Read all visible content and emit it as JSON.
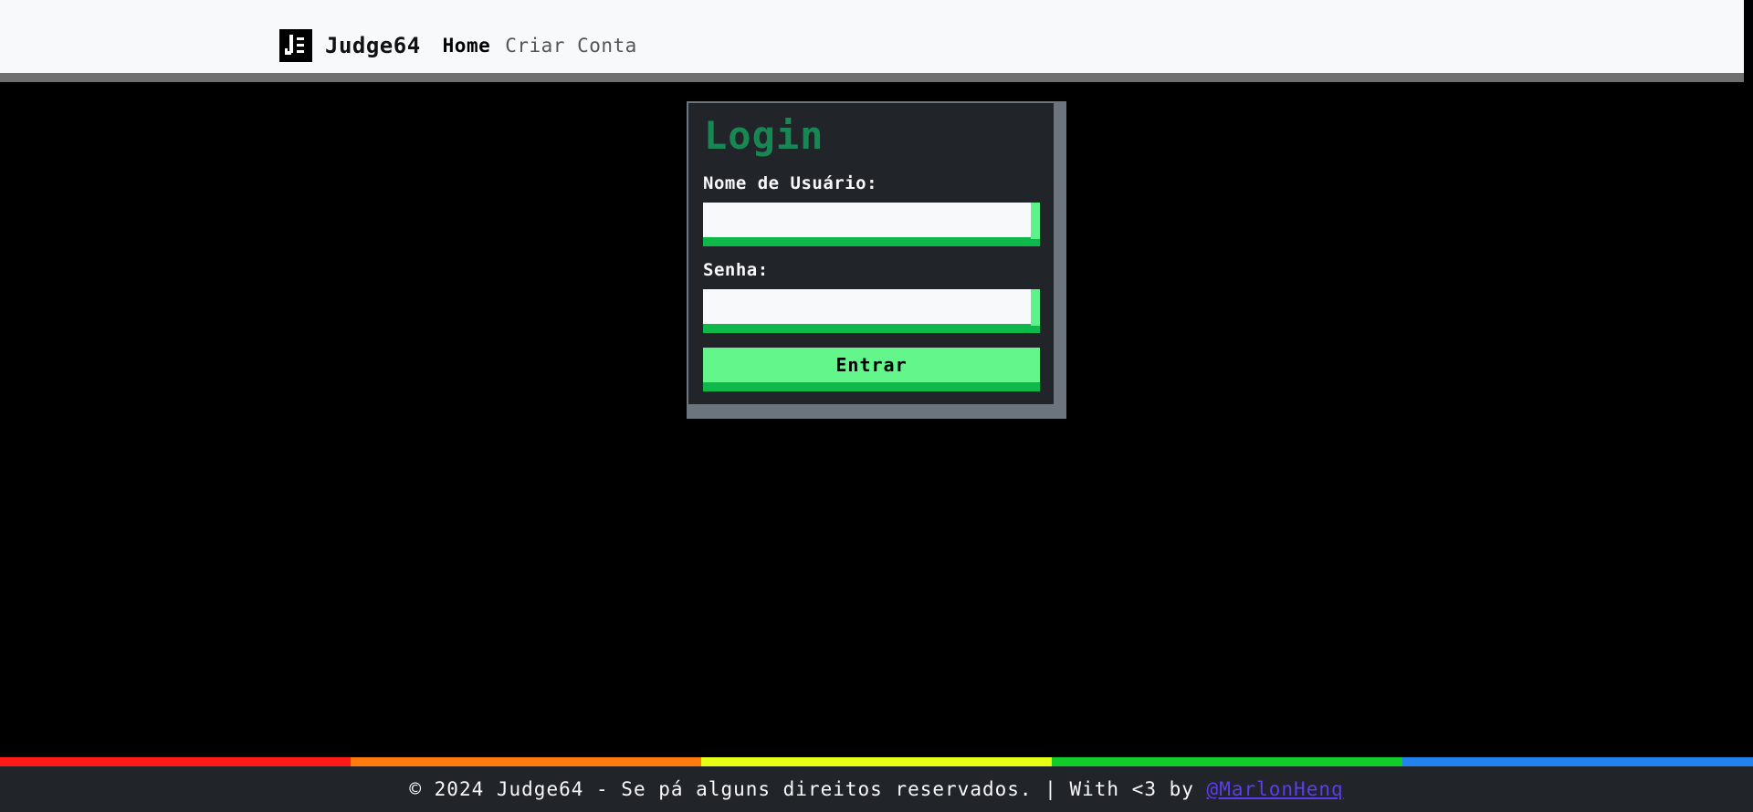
{
  "navbar": {
    "brand": "Judge64",
    "links": [
      {
        "label": "Home",
        "active": true
      },
      {
        "label": "Criar Conta",
        "active": false
      }
    ]
  },
  "login": {
    "title": "Login",
    "username_label": "Nome de Usuário:",
    "username_value": "",
    "password_label": "Senha:",
    "password_value": "",
    "submit_label": "Entrar"
  },
  "footer": {
    "text": "© 2024 Judge64 - Se pá alguns direitos reservados. | With <3 by",
    "author_link": "@MarlonHenq"
  },
  "colors": {
    "navbar_bg": "#f8f9fa",
    "page_bg": "#000000",
    "card_bg": "#212529",
    "title_green": "#198754",
    "input_green": "#0fb84a",
    "button_green": "#63f68a",
    "footer_bg": "#212529",
    "link_purple": "#5b3cf0",
    "rainbow": [
      "#ff1a1a",
      "#ff7a0f",
      "#e6ff14",
      "#12cc2b",
      "#2283ef"
    ]
  },
  "icons": {
    "logo": "judge64-logo-icon"
  }
}
